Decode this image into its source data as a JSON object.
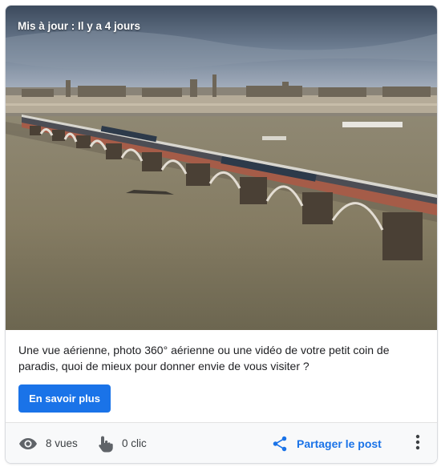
{
  "post": {
    "updated_label": "Mis à jour : Il y a 4 jours",
    "description": "Une vue aérienne, photo 360° aérienne ou une vidéo de votre petit coin de paradis, quoi de mieux pour donner envie de vous visiter ?",
    "cta_label": "En savoir plus"
  },
  "stats": {
    "views": "8 vues",
    "clicks": "0 clic"
  },
  "actions": {
    "share_label": "Partager le post"
  },
  "icons": {
    "views": "eye-icon",
    "clicks": "touch-hand-icon",
    "share": "share-icon",
    "more": "more-vertical-icon"
  },
  "colors": {
    "accent": "#1a73e8",
    "text": "#202124",
    "footer_bg": "#f8f9fa"
  }
}
